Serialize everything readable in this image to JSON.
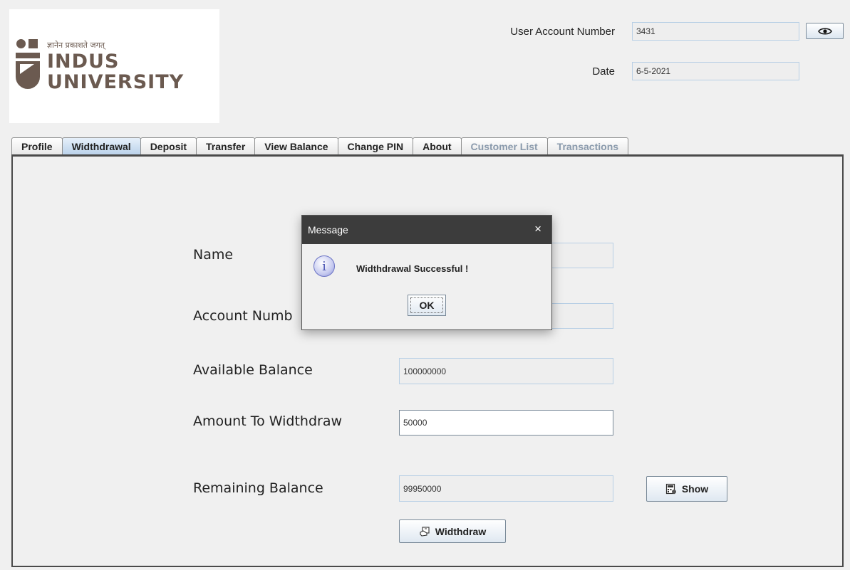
{
  "logo": {
    "tagline": "ज्ञानेन प्रकाशते जगत्",
    "line1": "INDUS",
    "line2": "UNIVERSITY"
  },
  "header": {
    "account_label": "User Account Number",
    "account_value": "3431",
    "date_label": "Date",
    "date_value": "6-5-2021"
  },
  "tabs": [
    {
      "label": "Profile",
      "state": "normal"
    },
    {
      "label": "Widthdrawal",
      "state": "active"
    },
    {
      "label": "Deposit",
      "state": "normal"
    },
    {
      "label": "Transfer",
      "state": "normal"
    },
    {
      "label": "View Balance",
      "state": "normal"
    },
    {
      "label": "Change PIN",
      "state": "normal"
    },
    {
      "label": "About",
      "state": "normal"
    },
    {
      "label": "Customer List",
      "state": "disabled"
    },
    {
      "label": "Transactions",
      "state": "disabled"
    }
  ],
  "form": {
    "name_label": "Name",
    "name_value": "",
    "account_label": "Account Numb",
    "account_value": "",
    "available_label": "Available Balance",
    "available_value": "100000000",
    "amount_label": "Amount To Widthdraw",
    "amount_value": "50000",
    "remaining_label": "Remaining Balance",
    "remaining_value": "99950000",
    "show_button": "Show",
    "withdraw_button": "Widthdraw"
  },
  "dialog": {
    "title": "Message",
    "close": "×",
    "info_glyph": "i",
    "message": "Widthdrawal Successful !",
    "ok": "OK"
  }
}
